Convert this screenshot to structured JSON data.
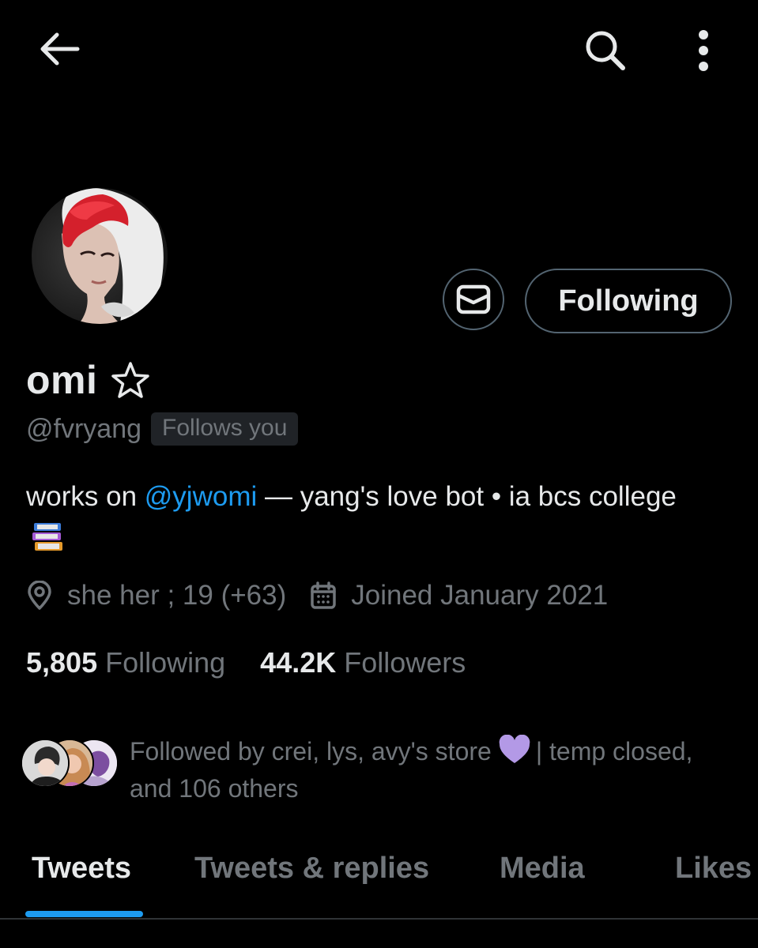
{
  "header": {
    "back_icon": "arrow-left-icon",
    "search_icon": "search-icon",
    "more_icon": "more-vertical-icon"
  },
  "profile": {
    "display_name": "omi",
    "name_suffix_icon": "star-outline-icon",
    "handle": "@fvryang",
    "follows_you": "Follows you",
    "bio": {
      "prefix": "works on ",
      "mention": "@yjwomi",
      "suffix": " — yang's love bot • ia bcs college",
      "emoji": "books-emoji"
    },
    "meta": {
      "location_text": "she her ; 19 (+63)",
      "joined_text": "Joined January 2021"
    },
    "stats": {
      "following_count": "5,805",
      "following_label": "Following",
      "followers_count": "44.2K",
      "followers_label": "Followers"
    },
    "followed_by": {
      "text_before": "Followed by crei, lys, avy's store",
      "text_after": "| temp closed, and 106 others",
      "heart_color": "#b399e6"
    }
  },
  "actions": {
    "message_icon": "mail-icon",
    "follow_label": "Following"
  },
  "tabs": [
    {
      "label": "Tweets",
      "active": true
    },
    {
      "label": "Tweets & replies",
      "active": false
    },
    {
      "label": "Media",
      "active": false
    },
    {
      "label": "Likes",
      "active": false
    }
  ],
  "colors": {
    "background": "#000000",
    "text_primary": "#e7e9ea",
    "text_secondary": "#71767b",
    "accent": "#1d9bf0",
    "border": "#536471"
  }
}
